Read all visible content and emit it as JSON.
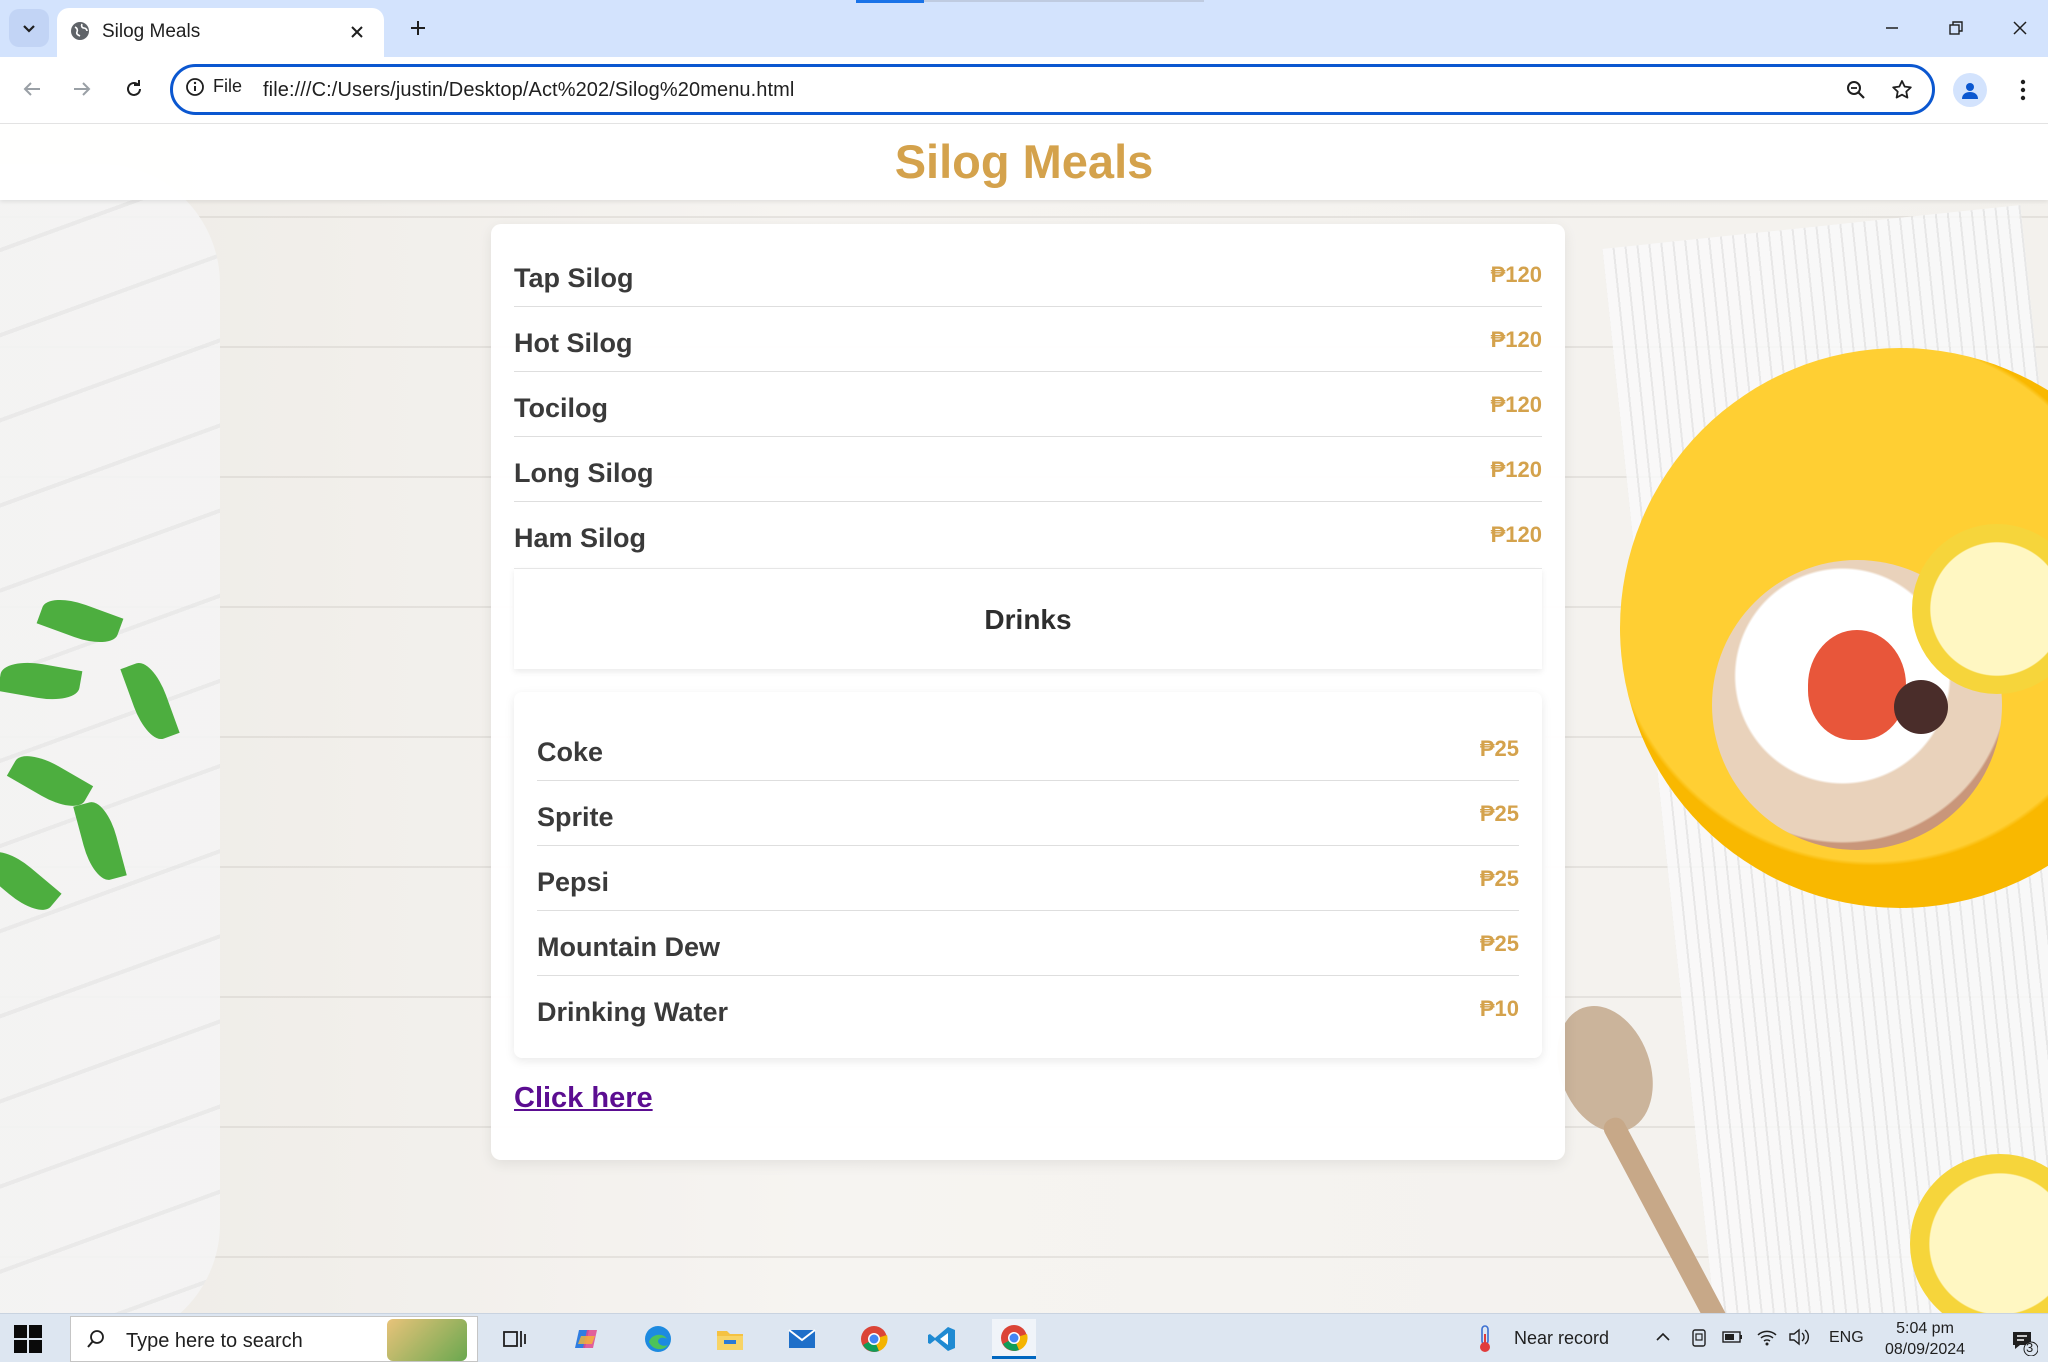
{
  "browser": {
    "tab_title": "Silog Meals",
    "site_info_label": "File",
    "url": "file:///C:/Users/justin/Desktop/Act%202/Silog%20menu.html"
  },
  "page": {
    "title": "Silog Meals",
    "meals": [
      {
        "name": "Tap Silog",
        "price": "₱120"
      },
      {
        "name": "Hot Silog",
        "price": "₱120"
      },
      {
        "name": "Tocilog",
        "price": "₱120"
      },
      {
        "name": "Long Silog",
        "price": "₱120"
      },
      {
        "name": "Ham Silog",
        "price": "₱120"
      }
    ],
    "drinks_heading": "Drinks",
    "drinks": [
      {
        "name": "Coke",
        "price": "₱25"
      },
      {
        "name": "Sprite",
        "price": "₱25"
      },
      {
        "name": "Pepsi",
        "price": "₱25"
      },
      {
        "name": "Mountain Dew",
        "price": "₱25"
      },
      {
        "name": "Drinking Water",
        "price": "₱10"
      }
    ],
    "link_text": "Click here"
  },
  "taskbar": {
    "search_placeholder": "Type here to search",
    "weather_text": "Near record",
    "language": "ENG",
    "time": "5:04 pm",
    "date": "08/09/2024",
    "notification_count": "3"
  },
  "colors": {
    "accent_gold": "#d4a24c",
    "link_purple": "#5b0d91",
    "browser_focus": "#0b57d0"
  }
}
